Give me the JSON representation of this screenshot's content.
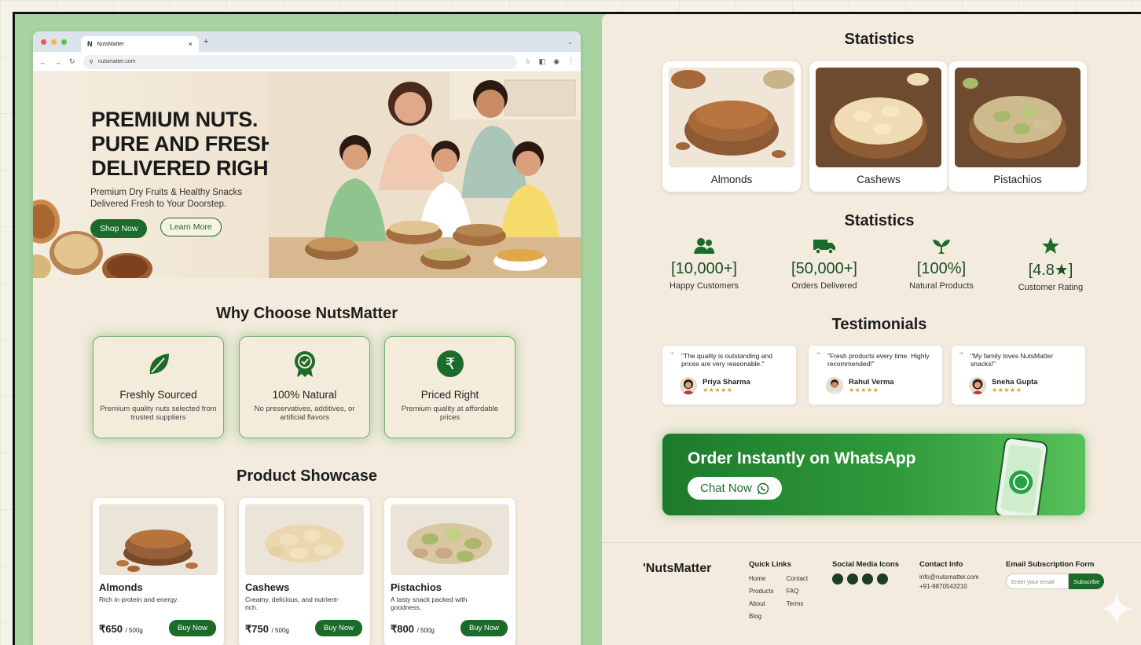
{
  "browser": {
    "tab_title": "NutsMatter",
    "tab_logo": "N",
    "url": "nutsmatter.com"
  },
  "hero": {
    "headline_1": "PREMIUM NUTS.",
    "headline_2": "PURE AND FRESH.",
    "headline_3": "DELIVERED RIGHT.",
    "subtitle_1": "Premium Dry Fruits & Healthy Snacks",
    "subtitle_2": "Delivered Fresh to Your Doorstep.",
    "shop_label": "Shop Now",
    "learn_label": "Learn More"
  },
  "why": {
    "title": "Why Choose NutsMatter",
    "features": [
      {
        "title": "Freshly Sourced",
        "desc": "Premium quality nuts selected from trusted suppliers",
        "icon": "leaf-icon"
      },
      {
        "title": "100% Natural",
        "desc": "No preservatives, additives, or artificial flavors",
        "icon": "badge-icon"
      },
      {
        "title": "Priced Right",
        "desc": "Premium quality at affordable prices",
        "icon": "rupee-icon"
      }
    ]
  },
  "showcase": {
    "title": "Product Showcase",
    "products": [
      {
        "name": "Almonds",
        "desc": "Rich in protein and energy.",
        "price": "₹650",
        "unit": "/ 500g",
        "buy": "Buy Now"
      },
      {
        "name": "Cashews",
        "desc": "Creamy, delicious, and nutrient-rich.",
        "price": "₹750",
        "unit": "/ 500g",
        "buy": "Buy Now"
      },
      {
        "name": "Pistachios",
        "desc": "A tasty snack packed with goodness.",
        "price": "₹800",
        "unit": "/ 500g",
        "buy": "Buy Now"
      }
    ]
  },
  "right": {
    "title_1": "Statistics",
    "stat_products": [
      "Almonds",
      "Cashews",
      "Pistachios"
    ],
    "title_2": "Statistics",
    "metrics": [
      {
        "value": "[10,000+]",
        "label": "Happy Customers",
        "icon": "users-icon"
      },
      {
        "value": "[50,000+]",
        "label": "Orders Delivered",
        "icon": "truck-icon"
      },
      {
        "value": "[100%]",
        "label": "Natural Products",
        "icon": "plant-icon"
      },
      {
        "value": "[4.8★]",
        "label": "Customer Rating",
        "icon": "star-icon"
      }
    ],
    "title_3": "Testimonials",
    "testimonials": [
      {
        "quote": "\"The quality is outstanding and prices are very reasonable.\"",
        "name": "Priya Sharma",
        "stars": "★★★★★"
      },
      {
        "quote": "\"Fresh products every time. Highly recommended!\"",
        "name": "Rahul Verma",
        "stars": "★★★★★"
      },
      {
        "quote": "\"My family loves NutsMatter snacks!\"",
        "name": "Sneha Gupta",
        "stars": "★★★★★"
      }
    ],
    "whatsapp": {
      "title": "Order Instantly on WhatsApp",
      "button": "Chat Now"
    }
  },
  "footer": {
    "brand": "'NutsMatter",
    "quick_links_title": "Quick Links",
    "links_col1": [
      "Home",
      "Products",
      "About",
      "Blog"
    ],
    "links_col2": [
      "Contact",
      "FAQ",
      "Terms"
    ],
    "social_title": "Social Media Icons",
    "contact_title": "Contact Info",
    "email": "info@nutsmatter.com",
    "phone": "+91-9870543210",
    "subscribe_title": "Email Subscription Form",
    "email_placeholder": "Enter your email",
    "subscribe_label": "Subscribe"
  },
  "colors": {
    "brand_green": "#1b6b2a",
    "frame_green": "#a9d4a2",
    "cream": "#f3ebdd"
  }
}
